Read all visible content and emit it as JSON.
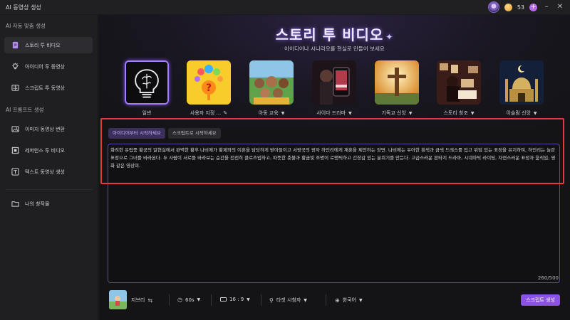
{
  "app": {
    "title": "AI 동영상 생성",
    "credits": "53"
  },
  "sidebar": {
    "section1": "AI 자동 맞춤 생성",
    "items1": [
      {
        "label": "스토리 투 비디오",
        "icon": "document-icon",
        "active": true
      },
      {
        "label": "아이디어 투 동영상",
        "icon": "lightbulb-icon"
      },
      {
        "label": "스크립트 투 동영상",
        "icon": "script-icon"
      }
    ],
    "section2": "AI 프롬프트 생성",
    "items2": [
      {
        "label": "이미지 동영상 변환",
        "icon": "image-icon"
      },
      {
        "label": "레퍼런스 투 비디오",
        "icon": "reference-icon"
      },
      {
        "label": "텍스트 동영상 생성",
        "icon": "text-icon"
      }
    ],
    "folder": {
      "label": "나의 창작물",
      "icon": "folder-icon"
    }
  },
  "hero": {
    "title": "스토리 투 비디오",
    "subtitle": "아이디어나 시나리오를 현실로 만들어 보세요"
  },
  "styles": [
    {
      "label": "일반",
      "dropdown": false,
      "selected": true
    },
    {
      "label": "사용자 지정 ...",
      "dropdown": false,
      "edit": true
    },
    {
      "label": "아동 교육",
      "dropdown": true
    },
    {
      "label": "사이다 드라마",
      "dropdown": true
    },
    {
      "label": "기독교 신앙",
      "dropdown": true
    },
    {
      "label": "스토리 창조",
      "dropdown": true
    },
    {
      "label": "이슬람 신앙",
      "dropdown": true
    }
  ],
  "tabs": [
    {
      "label": "아이디어부터 시작하세요",
      "active": true
    },
    {
      "label": "스크립트로 시작하세요",
      "active": false
    }
  ],
  "prompt": "화려한 유럽풍 황궁의 알현실에서 완벽한 황후 나비에가 황제와의 이혼을 담당하게 받아들이고 서왕국의 왕자 하인리에게 재혼을 제안하는 장면. 나비에는 우아한 흰색과 금색 드레스를 입고 위엄 있는 표정을 유지하며, 하인리는 놀란 표정으로 그녀를 바라본다. 두 사람이 서로를 바라보는 순간을 천천히 클로즈업하고, 따뜻한 촛불과 황금빛 조명이 로맨틱하고 긴장감 있는 분위기를 만든다. 고급스러운 판타지 드라마, 시네마틱 라이팅, 자연스러운 표정과 움직임, 영화 같은 영상미.",
  "counter": "260/500",
  "toolbar": {
    "voice": "지브리",
    "duration": "60s",
    "ratio": "16 : 9",
    "audience": "타겟 시청자",
    "language": "한국어",
    "generate": "스크립트 생성"
  }
}
